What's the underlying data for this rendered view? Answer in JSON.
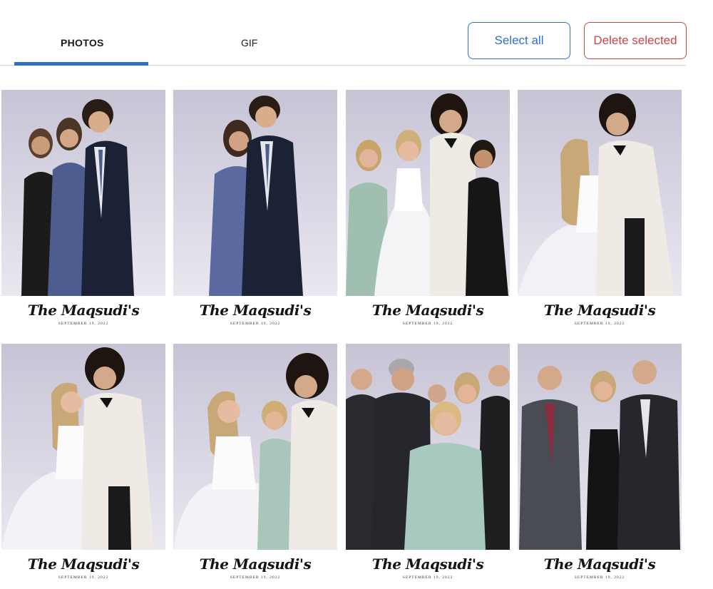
{
  "tabs": {
    "photos_label": "PHOTOS",
    "gif_label": "GIF",
    "active": "PHOTOS"
  },
  "actions": {
    "select_all_label": "Select all",
    "delete_selected_label": "Delete selected"
  },
  "colors": {
    "accent": "#2f6fc9",
    "danger": "#c8454a",
    "backdrop": "#d6d3e0"
  },
  "photos": [
    {
      "caption_script": "The Maqsudi's",
      "caption_date": "SEPTEMBER 19, 2022"
    },
    {
      "caption_script": "The Maqsudi's",
      "caption_date": "SEPTEMBER 19, 2022"
    },
    {
      "caption_script": "The Maqsudi's",
      "caption_date": "SEPTEMBER 19, 2022"
    },
    {
      "caption_script": "The Maqsudi's",
      "caption_date": "SEPTEMBER 19, 2022"
    },
    {
      "caption_script": "The Maqsudi's",
      "caption_date": "SEPTEMBER 19, 2022"
    },
    {
      "caption_script": "The Maqsudi's",
      "caption_date": "SEPTEMBER 19, 2022"
    },
    {
      "caption_script": "The Maqsudi's",
      "caption_date": "SEPTEMBER 19, 2022"
    },
    {
      "caption_script": "The Maqsudi's",
      "caption_date": "SEPTEMBER 19, 2022"
    }
  ]
}
